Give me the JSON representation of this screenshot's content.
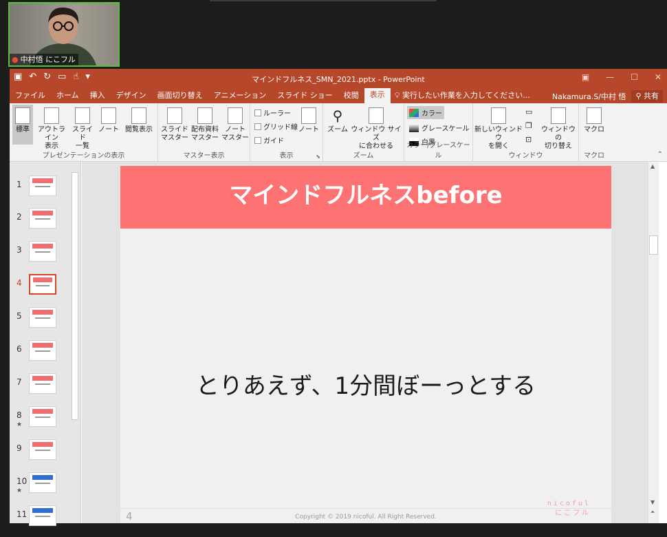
{
  "video": {
    "name": "中村悟 にこフル"
  },
  "titlebar": {
    "title": "マインドフルネス_SMN_2021.pptx - PowerPoint"
  },
  "tabs": [
    "ファイル",
    "ホーム",
    "挿入",
    "デザイン",
    "画面切り替え",
    "アニメーション",
    "スライド ショー",
    "校閲",
    "表示"
  ],
  "active_tab": "表示",
  "tell_me": "実行したい作業を入力してください...",
  "user": "Nakamura.S/中村 悟",
  "share_label": "共有",
  "ribbon": {
    "presentation_views": {
      "label": "プレゼンテーションの表示",
      "normal": "標準",
      "outline_1": "アウトライン",
      "outline_2": "表示",
      "sorter_1": "スライド",
      "sorter_2": "一覧",
      "notes": "ノート",
      "reading": "閲覧表示"
    },
    "master_views": {
      "label": "マスター表示",
      "slide_master_1": "スライド",
      "slide_master_2": "マスター",
      "handout_1": "配布資料",
      "handout_2": "マスター",
      "notes_master_1": "ノート",
      "notes_master_2": "マスター"
    },
    "show": {
      "label": "表示",
      "ruler": "ルーラー",
      "gridlines": "グリッド線",
      "guides": "ガイド",
      "notes": "ノート"
    },
    "zoom": {
      "label": "ズーム",
      "zoom": "ズーム",
      "fit_1": "ウィンドウ サイズ",
      "fit_2": "に合わせる"
    },
    "color": {
      "label": "カラー/グレースケール",
      "color": "カラー",
      "grayscale": "グレースケール",
      "bw": "白黒"
    },
    "window": {
      "label": "ウィンドウ",
      "new_1": "新しいウィンドウ",
      "new_2": "を開く",
      "switch_1": "ウィンドウの",
      "switch_2": "切り替え"
    },
    "macros": {
      "label": "マクロ",
      "macros": "マクロ"
    }
  },
  "thumbnails": [
    {
      "num": "1",
      "star": ""
    },
    {
      "num": "2",
      "star": ""
    },
    {
      "num": "3",
      "star": ""
    },
    {
      "num": "4",
      "star": ""
    },
    {
      "num": "5",
      "star": ""
    },
    {
      "num": "6",
      "star": ""
    },
    {
      "num": "7",
      "star": ""
    },
    {
      "num": "8",
      "star": "★"
    },
    {
      "num": "9",
      "star": ""
    },
    {
      "num": "10",
      "star": "★"
    },
    {
      "num": "11",
      "star": ""
    }
  ],
  "active_slide": "4",
  "slide": {
    "title": "マインドフルネスbefore",
    "body": "とりあえず、1分間ぼーっとする",
    "page": "4",
    "copyright": "Copyright © 2019 nicoful. All Right Reserved.",
    "logo_1": "nicoful",
    "logo_2": "にこフル"
  },
  "colors": {
    "accent": "#b7472a",
    "slide_banner": "#fd7273",
    "active_thumb": "#d24726"
  }
}
